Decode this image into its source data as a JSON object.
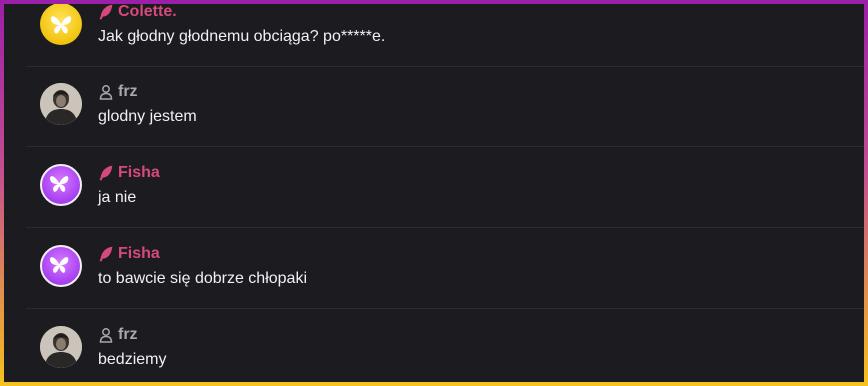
{
  "colors": {
    "pink_role": "#d6497f",
    "gray_role": "#a9a8ad",
    "background": "#1c1b1f"
  },
  "messages": [
    {
      "author": "Colette.",
      "role_icon": "feather-icon",
      "avatar": "butterfly-yellow",
      "text": "Jak głodny głodnemu obciąga? po*****e."
    },
    {
      "author": "frz",
      "role_icon": "person-icon",
      "avatar": "photo",
      "text": "glodny jestem"
    },
    {
      "author": "Fisha",
      "role_icon": "feather-icon",
      "avatar": "butterfly-purple",
      "text": "ja nie"
    },
    {
      "author": "Fisha",
      "role_icon": "feather-icon",
      "avatar": "butterfly-purple",
      "text": "to bawcie się dobrze chłopaki"
    },
    {
      "author": "frz",
      "role_icon": "person-icon",
      "avatar": "photo",
      "text": "bedziemy"
    }
  ]
}
